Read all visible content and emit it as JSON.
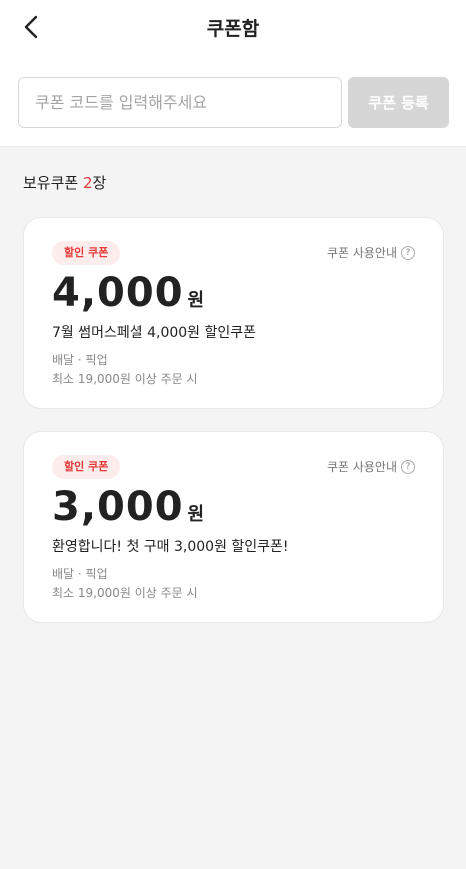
{
  "header": {
    "title": "쿠폰함"
  },
  "coupon_input": {
    "placeholder": "쿠폰 코드를 입력해주세요",
    "register_label": "쿠폰 등록"
  },
  "summary": {
    "prefix": "보유쿠폰 ",
    "count": "2",
    "suffix": "장"
  },
  "coupons": [
    {
      "badge": "할인 쿠폰",
      "guide": "쿠폰 사용안내",
      "amount": "4,000",
      "unit": "원",
      "name": "7월 썸머스페셜 4,000원 할인쿠폰",
      "methods": "배달 · 픽업",
      "condition": "최소 19,000원 이상 주문 시"
    },
    {
      "badge": "할인 쿠폰",
      "guide": "쿠폰 사용안내",
      "amount": "3,000",
      "unit": "원",
      "name": "환영합니다! 첫 구매 3,000원 할인쿠폰!",
      "methods": "배달 · 픽업",
      "condition": "최소 19,000원 이상 주문 시"
    }
  ],
  "colors": {
    "accent": "#e63a3a",
    "badge_bg": "#fdecec",
    "button_disabled": "#d6d6d6"
  }
}
